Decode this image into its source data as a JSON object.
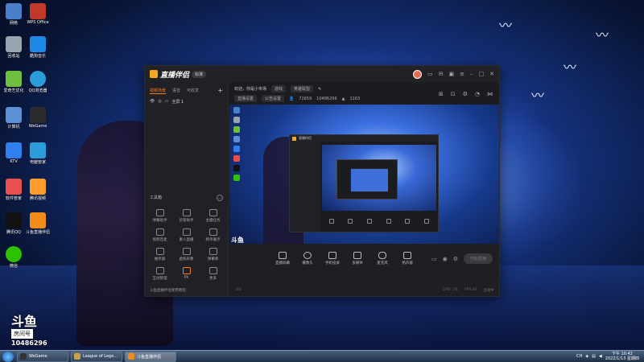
{
  "desktop": {
    "icons": [
      {
        "label": "网络",
        "color": "#4a7fc9"
      },
      {
        "label": "WPS Office",
        "color": "#c0392b"
      },
      {
        "label": "回收站",
        "color": "#9aa4b0"
      },
      {
        "label": "酷狗音乐",
        "color": "#1e88e5"
      },
      {
        "label": "爱奇艺优化",
        "color": "#6fbf3f"
      },
      {
        "label": "QQ浏览器",
        "color": "#2d9cdb"
      },
      {
        "label": "计算机",
        "color": "#5c8fd6"
      },
      {
        "label": "WeGame",
        "color": "#2b2b2b"
      },
      {
        "label": "KTV",
        "color": "#2f80ed"
      },
      {
        "label": "电脑管家",
        "color": "#2d9cdb"
      },
      {
        "label": "软件管家",
        "color": "#e94f4f"
      },
      {
        "label": "腾讯视频",
        "color": "#ff9d2e"
      },
      {
        "label": "腾讯QQ",
        "color": "#111111"
      },
      {
        "label": "斗鱼直播伴侣",
        "color": "#f08c1a"
      },
      {
        "label": "微信",
        "color": "#2dc100"
      }
    ],
    "watermark": {
      "logo": "斗鱼",
      "badge": "房间号",
      "room": "10486296"
    }
  },
  "app": {
    "brand": "直播伴侣",
    "version": "标准",
    "titlebar_icons": [
      "message-icon",
      "mail-icon",
      "screen-icon",
      "menu-icon",
      "minimize-icon",
      "maximize-icon",
      "close-icon"
    ],
    "sidebar": {
      "tabs": [
        "视频场景",
        "语音",
        "可收发"
      ],
      "scene": {
        "toggle": "◎",
        "name": "全屏 1"
      },
      "tools_title": "工具箱",
      "tools": [
        {
          "label": "弹幕助手"
        },
        {
          "label": "房管助手"
        },
        {
          "label": "主播任务"
        },
        {
          "label": "视频连麦"
        },
        {
          "label": "素人直播"
        },
        {
          "label": "榜单展示"
        },
        {
          "label": "抽奖器"
        },
        {
          "label": "虚拟形象"
        },
        {
          "label": "弹幕库"
        },
        {
          "label": "互动管理"
        },
        {
          "label": "PK"
        },
        {
          "label": "更多"
        }
      ],
      "footer": "斗鱼直播伴侣使用教程"
    },
    "info": {
      "room_title": "欢迎，你是小专场",
      "category": "游戏",
      "category2": "英雄联盟",
      "line2_a": "直播设置",
      "line2_b": "公告设置",
      "viewers": "72659",
      "room_id": "10486296",
      "hot": "1163"
    },
    "bottom_buttons": [
      {
        "label": "直播屏幕"
      },
      {
        "label": "摄像头"
      },
      {
        "label": "手机投屏"
      },
      {
        "label": "多媒体"
      },
      {
        "label": "麦克风"
      },
      {
        "label": "扬声器"
      }
    ],
    "start_live": "开始直播",
    "status": {
      "left": "0%",
      "right": [
        "CPU: 1%",
        "FPS:30",
        "直播中"
      ]
    }
  },
  "taskbar": {
    "tasks": [
      {
        "label": "WeGame",
        "color": "#333333"
      },
      {
        "label": "League of Lege...",
        "color": "#c8a24a"
      },
      {
        "label": "斗鱼直播伴侣",
        "color": "#f08c1a"
      }
    ],
    "tray_lang": "CH",
    "time": "下午 10:42",
    "date": "2022/1/13 星期四"
  }
}
